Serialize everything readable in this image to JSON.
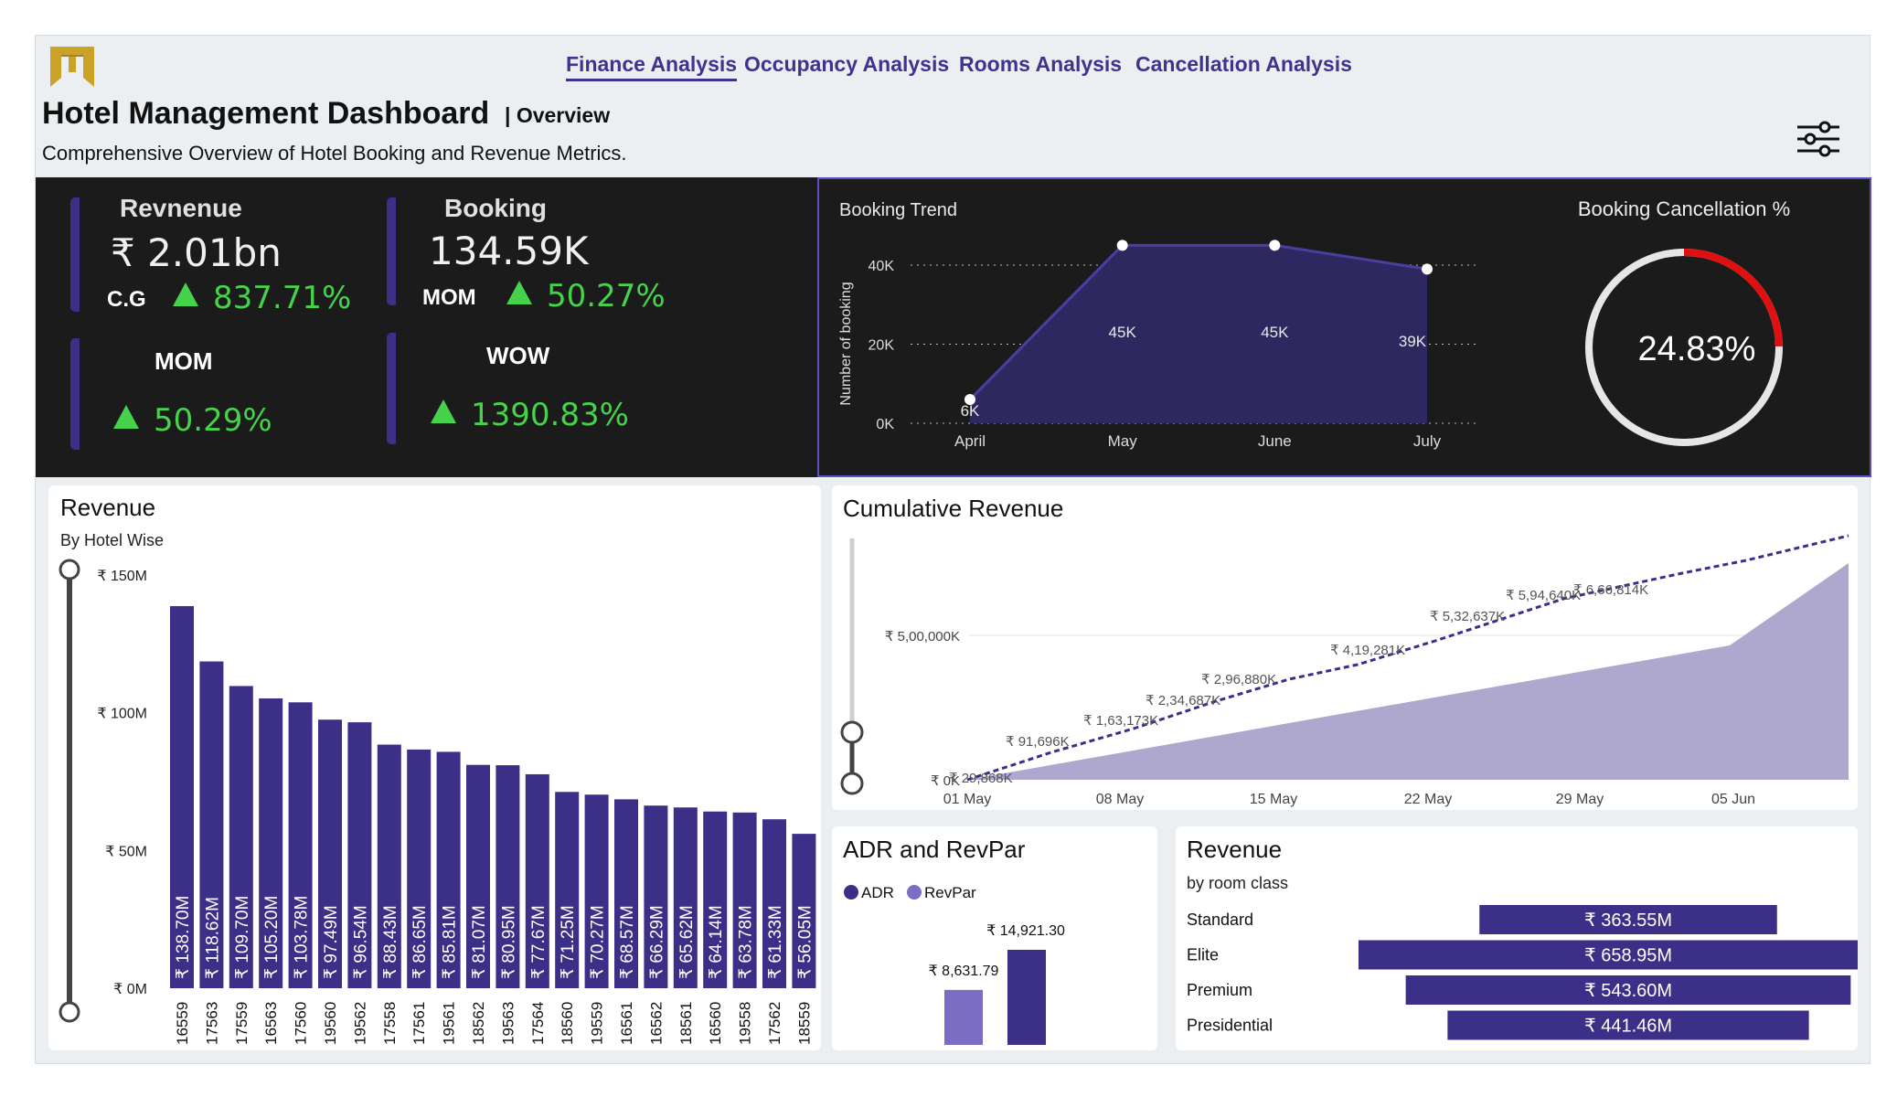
{
  "nav": {
    "items": [
      {
        "label": "Finance Analysis",
        "active": true
      },
      {
        "label": "Occupancy Analysis",
        "active": false
      },
      {
        "label": "Rooms Analysis",
        "active": false
      },
      {
        "label": "Cancellation Analysis",
        "active": false
      }
    ]
  },
  "header": {
    "title": "Hotel Management Dashboard",
    "subtitle": "| Overview",
    "description": "Comprehensive Overview of Hotel Booking and Revenue Metrics."
  },
  "icons": {
    "logo": "hotel-logo-icon",
    "filter": "filter-sliders-icon"
  },
  "colors": {
    "accent": "#3b2f88",
    "positive": "#46d24a",
    "cancel": "#e01010",
    "area": "#aea8cf"
  },
  "kpis": {
    "revenue": {
      "label": "Revnenue",
      "value": "₹ 2.01bn",
      "badge": "C.G",
      "change": "837.71%"
    },
    "booking": {
      "label": "Booking",
      "value": "134.59K",
      "badge": "MOM",
      "change": "50.27%"
    },
    "revenue_mom": {
      "label": "MOM",
      "change": "50.29%"
    },
    "booking_wow": {
      "label": "WOW",
      "change": "1390.83%"
    }
  },
  "booking_cancellation": {
    "title": "Booking Cancellation %",
    "value": "24.83%",
    "fraction": 0.2483
  },
  "chart_data": [
    {
      "id": "booking-trend",
      "type": "area",
      "title": "Booking Trend",
      "ylabel": "Number of booking",
      "categories": [
        "April",
        "May",
        "June",
        "July"
      ],
      "values": [
        6,
        45,
        45,
        39
      ],
      "value_labels": [
        "6K",
        "45K",
        "45K",
        "39K"
      ],
      "y_ticks": [
        "0K",
        "20K",
        "40K"
      ],
      "ylim": [
        0,
        40
      ],
      "grid": true
    },
    {
      "id": "revenue-by-hotel",
      "type": "bar",
      "title": "Revenue",
      "subtitle": "By Hotel Wise",
      "categories": [
        "16559",
        "17563",
        "17559",
        "16563",
        "17560",
        "19560",
        "19562",
        "17558",
        "17561",
        "19561",
        "18562",
        "19563",
        "17564",
        "18560",
        "19559",
        "16561",
        "16562",
        "18561",
        "16560",
        "19558",
        "17562",
        "18559"
      ],
      "values": [
        138.7,
        118.62,
        109.7,
        105.2,
        103.78,
        97.49,
        96.54,
        88.43,
        86.65,
        85.81,
        81.07,
        80.95,
        77.67,
        71.25,
        70.27,
        68.57,
        66.29,
        65.62,
        64.14,
        63.78,
        61.33,
        56.05
      ],
      "value_labels": [
        "₹ 138.70M",
        "₹ 118.62M",
        "₹ 109.70M",
        "₹ 105.20M",
        "₹ 103.78M",
        "₹ 97.49M",
        "₹ 96.54M",
        "₹ 88.43M",
        "₹ 86.65M",
        "₹ 85.81M",
        "₹ 81.07M",
        "₹ 80.95M",
        "₹ 77.67M",
        "₹ 71.25M",
        "₹ 70.27M",
        "₹ 68.57M",
        "₹ 66.29M",
        "₹ 65.62M",
        "₹ 64.14M",
        "₹ 63.78M",
        "₹ 61.33M",
        "₹ 56.05M"
      ],
      "y_ticks": [
        "₹ 0M",
        "₹ 50M",
        "₹ 100M",
        "₹ 150M"
      ],
      "ylim": [
        0,
        150
      ]
    },
    {
      "id": "cumulative-revenue",
      "type": "area",
      "title": "Cumulative Revenue",
      "x_ticks": [
        "01 May",
        "08 May",
        "15 May",
        "22 May",
        "29 May",
        "05 Jun"
      ],
      "y_ticks": [
        "₹ 0K",
        "₹ 5,00,000K"
      ],
      "point_labels": [
        "₹ 29,868K",
        "₹ 91,696K",
        "₹ 1,63,173K",
        "₹ 2,34,687K",
        "₹ 2,96,880K",
        "₹ 4,19,281K",
        "₹ 5,32,637K",
        "₹ 5,94,640K",
        "₹ 6,66,814K"
      ],
      "ylim": [
        0,
        500000
      ]
    },
    {
      "id": "adr-revpar",
      "type": "bar",
      "title": "ADR and RevPar",
      "series": [
        {
          "name": "ADR",
          "value": 14921.3,
          "label": "₹ 14,921.30",
          "color": "#3b2f88"
        },
        {
          "name": "RevPar",
          "value": 8631.79,
          "label": "₹ 8,631.79",
          "color": "#7b6cc4"
        }
      ]
    },
    {
      "id": "revenue-room-class",
      "type": "bar",
      "title": "Revenue",
      "subtitle": "by room class",
      "categories": [
        "Standard",
        "Elite",
        "Premium",
        "Presidential"
      ],
      "values": [
        363.55,
        658.95,
        543.6,
        441.46
      ],
      "value_labels": [
        "₹ 363.55M",
        "₹ 658.95M",
        "₹ 543.60M",
        "₹ 441.46M"
      ]
    }
  ]
}
